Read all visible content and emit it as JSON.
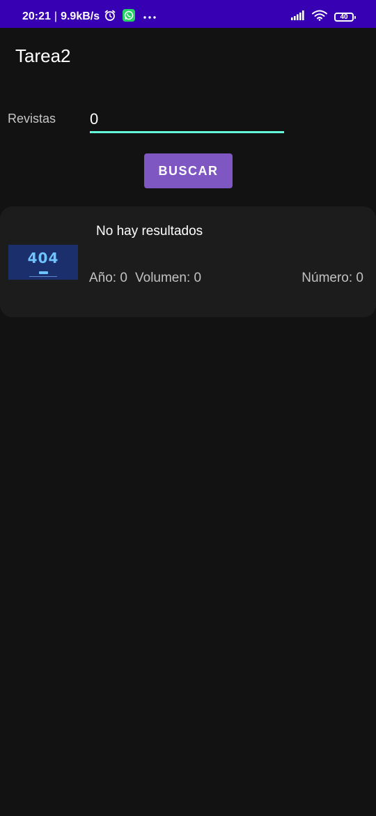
{
  "status_bar": {
    "time": "20:21",
    "separator": "|",
    "network_speed": "9.9kB/s",
    "battery_level": "40",
    "icons": [
      "alarm-icon",
      "whatsapp-icon",
      "more-dots-icon",
      "signal-icon",
      "wifi-icon",
      "battery-icon"
    ],
    "background_color": "#3700b3"
  },
  "app": {
    "title": "Tarea2"
  },
  "search": {
    "label": "Revistas",
    "value": "0",
    "underline_color": "#64ffda",
    "button_label": "BUSCAR",
    "button_color": "#7e57c2"
  },
  "results": [
    {
      "title": "No hay resultados",
      "year_label": "Año: 0",
      "volume_label": "Volumen: 0",
      "number_label": "Número: 0",
      "thumbnail_text": "404"
    }
  ],
  "colors": {
    "background": "#121212",
    "card": "#1c1c1c"
  }
}
